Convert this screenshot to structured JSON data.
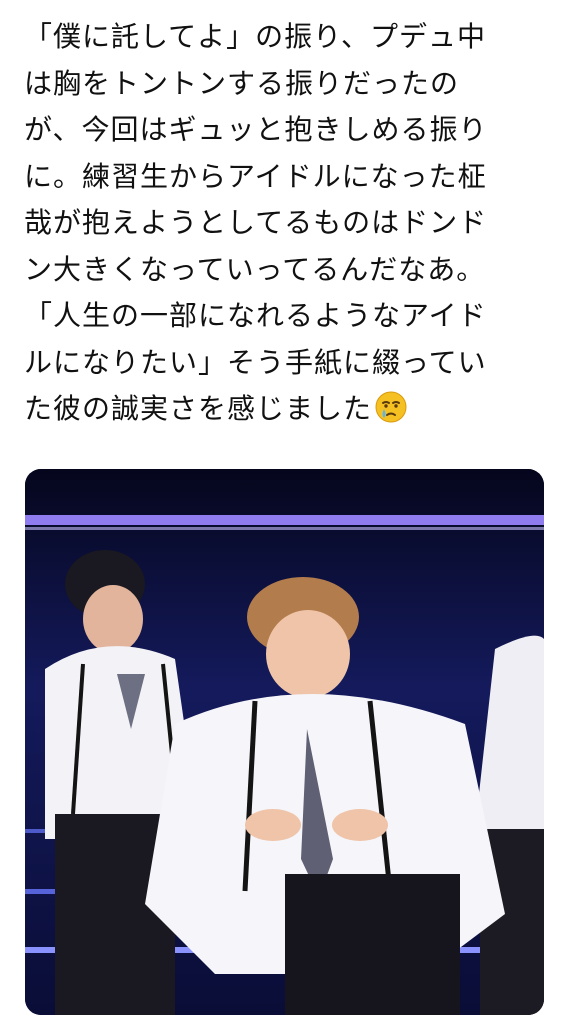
{
  "post": {
    "lines": [
      "「僕に託してよ」の振り、プデュ中",
      "は胸をトントンする振りだったの",
      "が、今回はギュッと抱きしめる振り",
      "に。練習生からアイドルになった柾",
      "哉が抱えようとしてるものはドンド",
      "ン大きくなっていってるんだなあ。",
      "「人生の一部になれるようなアイド",
      "ルになりたい」そう手紙に綴ってい",
      "た彼の誠実さを感じました"
    ],
    "trailing_emoji": "crying-face-icon"
  },
  "media": {
    "icon": "performance-photo-icon"
  }
}
